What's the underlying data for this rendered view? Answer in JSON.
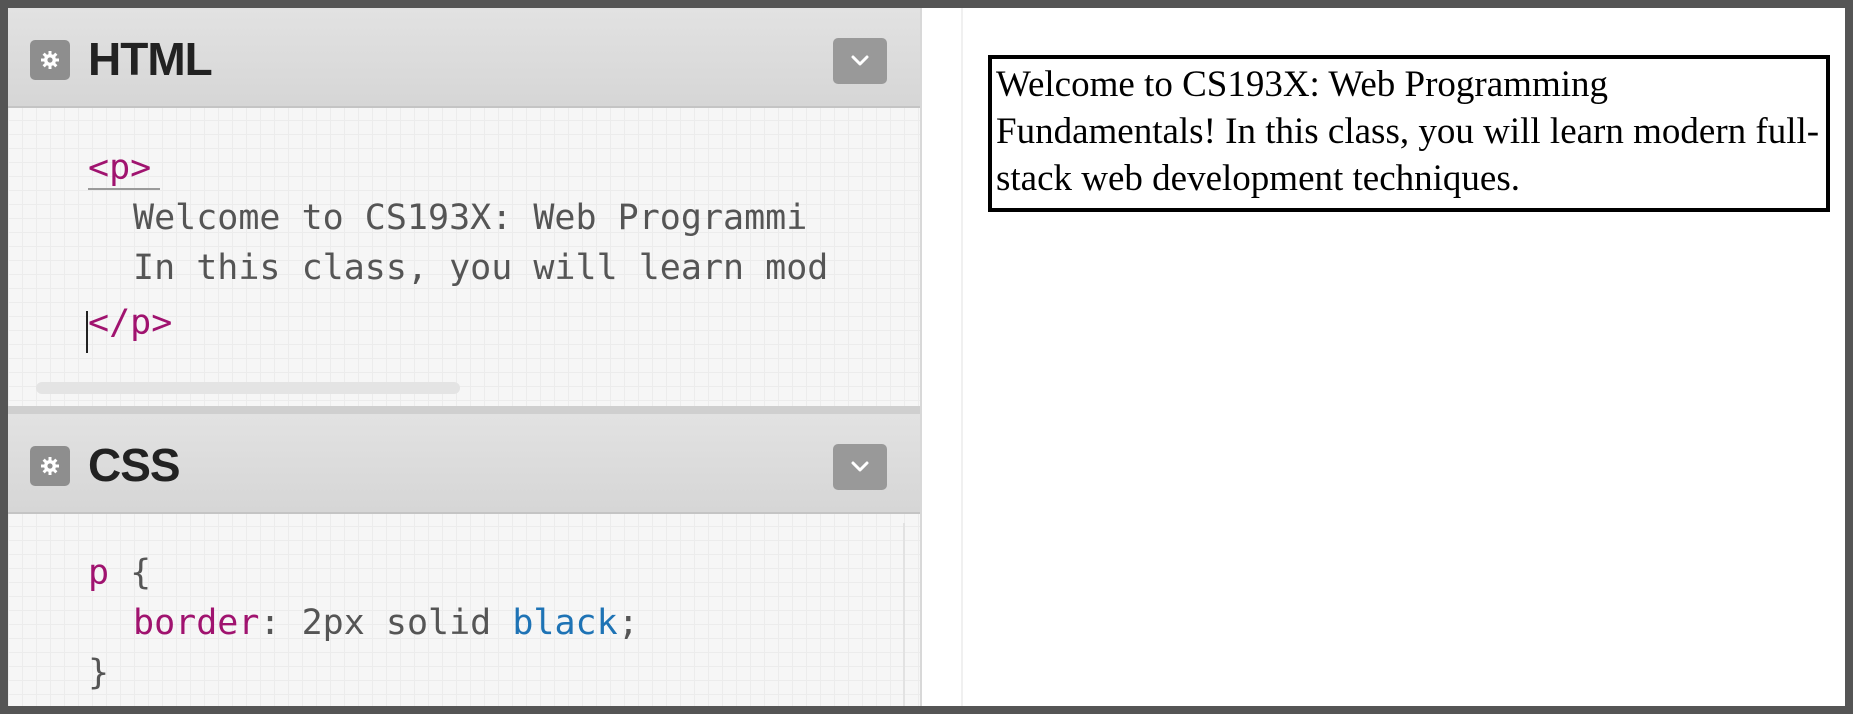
{
  "html_panel": {
    "title": "HTML",
    "lines": [
      {
        "open_tag": "<p>"
      },
      {
        "text": "Welcome to CS193X: Web Programmi"
      },
      {
        "text": "In this class, you will learn mod"
      },
      {
        "close_tag": "</p>"
      }
    ]
  },
  "css_panel": {
    "title": "CSS",
    "selector": "p",
    "open_brace": "{",
    "property": "border",
    "colon": ":",
    "value_plain": "2px solid",
    "value_keyword": "black",
    "semicolon": ";",
    "close_brace": "}"
  },
  "preview": {
    "paragraph": "Welcome to CS193X: Web Programming Fundamentals! In this class, you will learn modern full-stack web development techniques."
  },
  "icons": {
    "settings": "gear-icon",
    "collapse": "chevron-down-icon"
  },
  "colors": {
    "tag": "#a0136f",
    "keyword": "#1e73b5",
    "header_bg": "#d6d6d6",
    "frame": "#555555"
  }
}
